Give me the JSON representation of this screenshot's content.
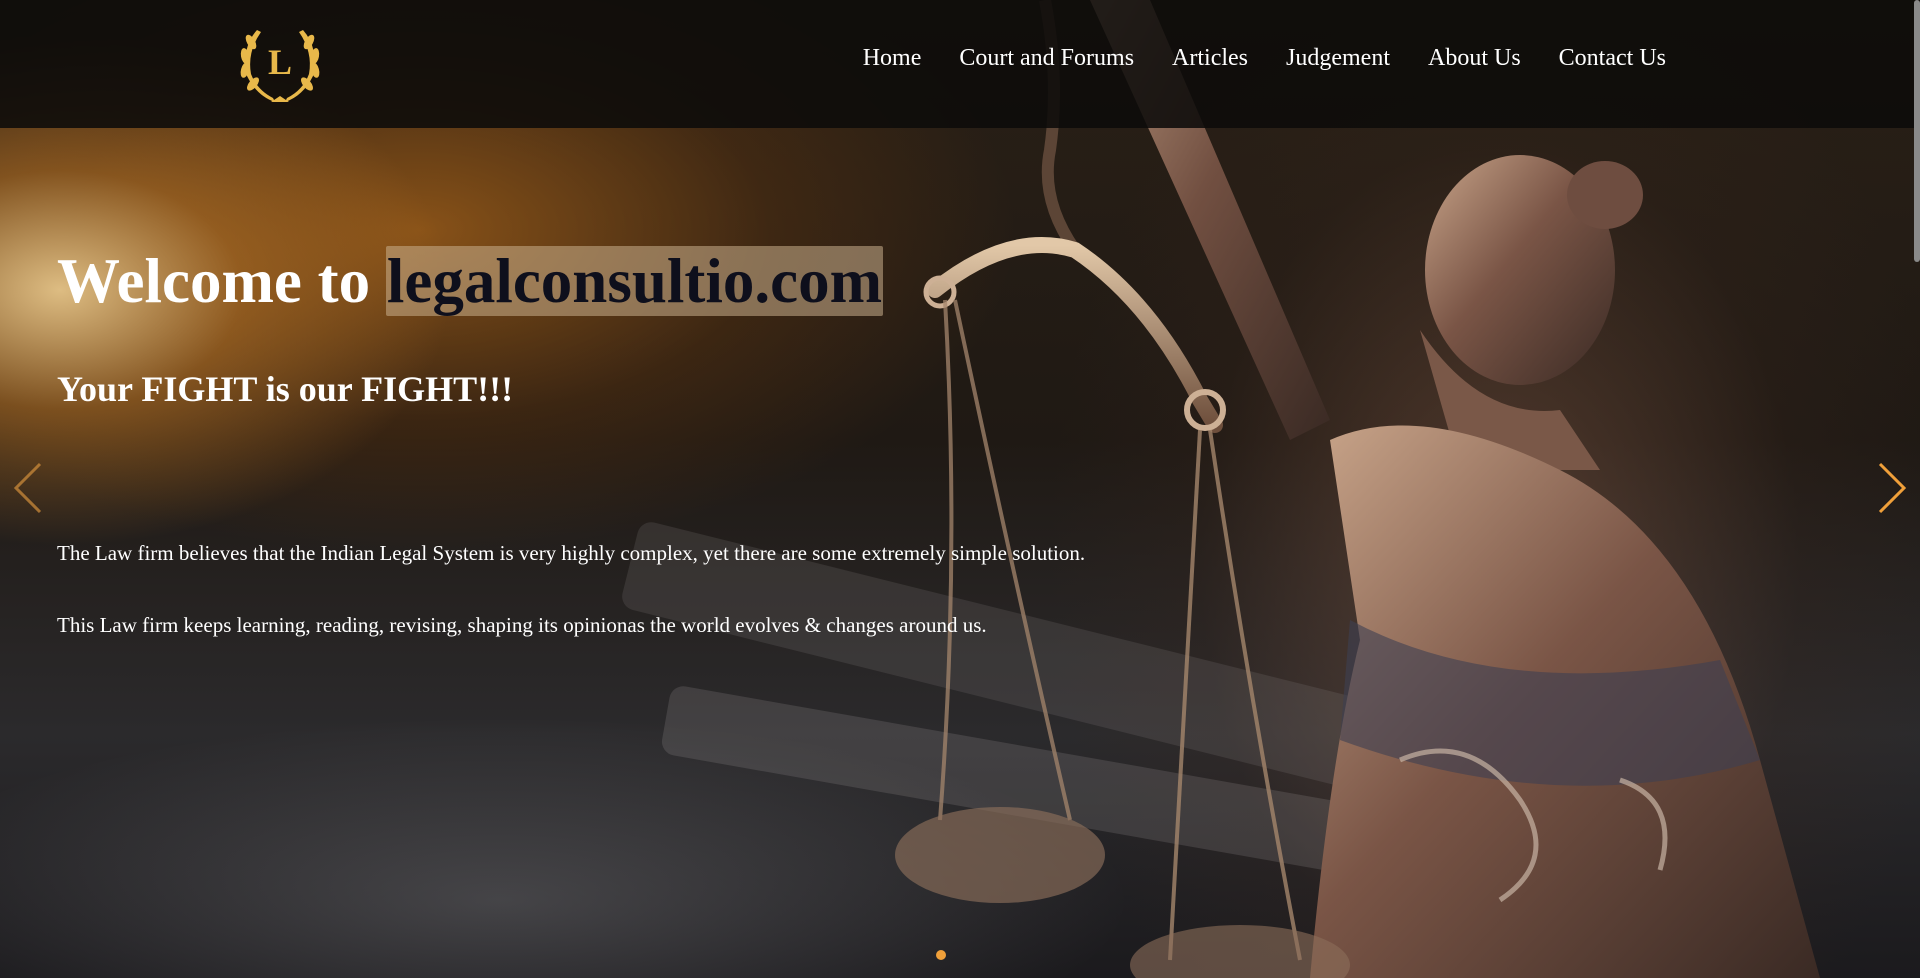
{
  "brand": {
    "logo_letter": "L",
    "accent": "#f0a03a",
    "logo_color": "#e8b84a"
  },
  "nav": {
    "items": [
      {
        "label": "Home"
      },
      {
        "label": "Court and Forums"
      },
      {
        "label": "Articles"
      },
      {
        "label": "Judgement"
      },
      {
        "label": "About Us"
      },
      {
        "label": "Contact Us"
      }
    ]
  },
  "hero": {
    "title_prefix": "Welcome to ",
    "title_domain": "legalconsultio.com",
    "subtitle": "Your FIGHT is our FIGHT!!!",
    "paragraph_1": "The Law firm believes that the Indian Legal System is very highly complex, yet there are some extremely simple solution.",
    "paragraph_2": "This Law firm keeps learning, reading, revising, shaping its opinionas the world evolves & changes around us.",
    "prev_icon": "chevron-left-icon",
    "next_icon": "chevron-right-icon"
  },
  "carousel": {
    "active_slide": 1,
    "slide_count": 1
  }
}
